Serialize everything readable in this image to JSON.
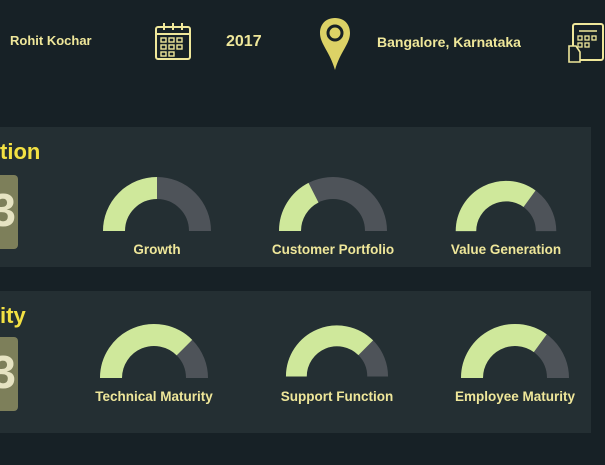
{
  "header": {
    "name": "Rohit Kochar",
    "year": "2017",
    "location": "Bangalore, Karnataka",
    "icons": [
      "calendar-icon",
      "location-pin-icon",
      "document-hand-icon"
    ]
  },
  "colors": {
    "background": "#172126",
    "panel": "#242f33",
    "gauge_fill": "#cfe89b",
    "gauge_track": "#4e5359",
    "label": "#efe79a",
    "title": "#f3e143",
    "badge": "#7d7f5a"
  },
  "panels": [
    {
      "title_visible": "tion",
      "badge_visible": "3",
      "gauges": [
        {
          "label": "Growth",
          "level": 0.5
        },
        {
          "label": "Customer Portfolio",
          "level": 0.35
        },
        {
          "label": "Value Generation",
          "level": 0.7
        }
      ]
    },
    {
      "title_visible": "ity",
      "badge_visible": "3",
      "gauges": [
        {
          "label": "Technical Maturity",
          "level": 0.75
        },
        {
          "label": "Support Function",
          "level": 0.75
        },
        {
          "label": "Employee Maturity",
          "level": 0.7
        }
      ]
    }
  ]
}
